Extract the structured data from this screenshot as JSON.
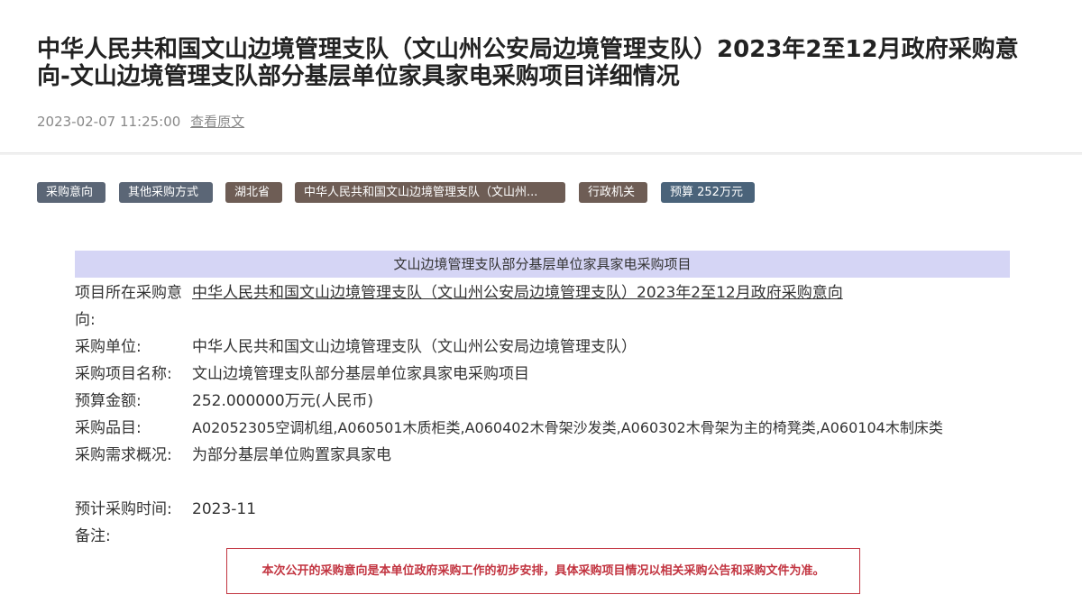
{
  "page": {
    "title": "中华人民共和国文山边境管理支队（文山州公安局边境管理支队）2023年2至12月政府采购意向-文山边境管理支队部分基层单位家具家电采购项目详细情况",
    "datetime": "2023-02-07 11:25:00",
    "view_original": "查看原文"
  },
  "tags": [
    {
      "label": "采购意向",
      "color": "#5b6676"
    },
    {
      "label": "其他采购方式",
      "color": "#5b6676"
    },
    {
      "label": "湖北省",
      "color": "#6e5d55"
    },
    {
      "label": "中华人民共和国文山边境管理支队（文山州...",
      "color": "#6e5d55"
    },
    {
      "label": "行政机关",
      "color": "#6e5d55"
    },
    {
      "label": "预算 252万元",
      "color": "#4a637a"
    }
  ],
  "table": {
    "header": "文山边境管理支队部分基层单位家具家电采购项目",
    "rows": [
      {
        "label": "项目所在采购意向:",
        "value": "中华人民共和国文山边境管理支队（文山州公安局边境管理支队）2023年2至12月政府采购意向"
      },
      {
        "label": "采购单位:",
        "value": "中华人民共和国文山边境管理支队（文山州公安局边境管理支队）"
      },
      {
        "label": "采购项目名称:",
        "value": "文山边境管理支队部分基层单位家具家电采购项目"
      },
      {
        "label": "预算金额:",
        "value": "252.000000万元(人民币)"
      },
      {
        "label": "采购品目:",
        "value": "A02052305空调机组,A060501木质柜类,A060402木骨架沙发类,A060302木骨架为主的椅凳类,A060104木制床类"
      },
      {
        "label": "采购需求概况:",
        "value": "为部分基层单位购置家具家电"
      },
      {
        "label": "预计采购时间:",
        "value": "2023-11"
      },
      {
        "label": "备注:",
        "value": ""
      }
    ]
  },
  "notice": "本次公开的采购意向是本单位政府采购工作的初步安排，具体采购项目情况以相关采购公告和采购文件为准。"
}
